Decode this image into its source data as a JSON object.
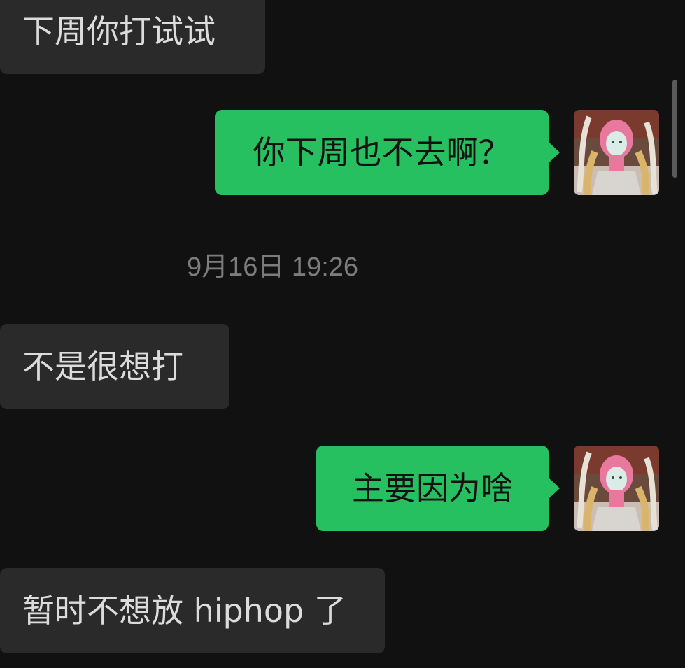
{
  "messages": [
    {
      "side": "incoming",
      "text": "下周你打试试"
    },
    {
      "side": "outgoing",
      "text": "你下周也不去啊？"
    },
    {
      "side": "incoming",
      "text": "不是很想打"
    },
    {
      "side": "outgoing",
      "text": "主要因为啥"
    },
    {
      "side": "incoming",
      "text": "暂时不想放 hiphop 了"
    }
  ],
  "timestamp": "9月16日 19:26",
  "colors": {
    "background": "#111111",
    "incoming_bubble": "#2a2a2a",
    "outgoing_bubble": "#27c061",
    "incoming_text": "#dcdcdc",
    "outgoing_text": "#121212",
    "timestamp_text": "#7c7c7c"
  },
  "icons": {
    "avatar": "anime-character-avatar"
  }
}
